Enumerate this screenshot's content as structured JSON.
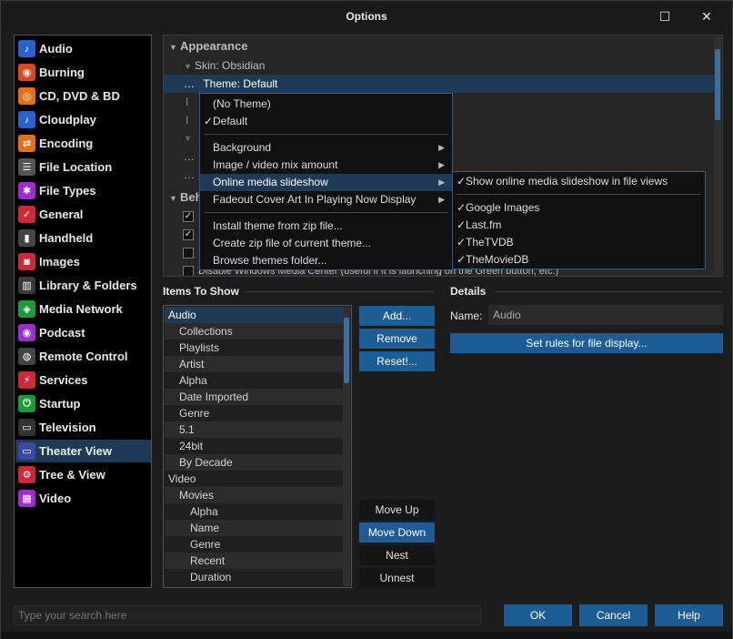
{
  "window": {
    "title": "Options",
    "maximize_glyph": "☐",
    "close_glyph": "✕"
  },
  "sidebar": {
    "items": [
      {
        "label": "Audio",
        "icon": "music-note-icon",
        "glyph": "♪",
        "color": "#2a62c9"
      },
      {
        "label": "Burning",
        "icon": "disc-burn-icon",
        "glyph": "◉",
        "color": "#d84a24"
      },
      {
        "label": "CD, DVD & BD",
        "icon": "cd-icon",
        "glyph": "◎",
        "color": "#e0701c"
      },
      {
        "label": "Cloudplay",
        "icon": "cloud-music-icon",
        "glyph": "♪",
        "color": "#2a62c9"
      },
      {
        "label": "Encoding",
        "icon": "convert-icon",
        "glyph": "⇄",
        "color": "#e0701c"
      },
      {
        "label": "File Location",
        "icon": "file-list-icon",
        "glyph": "☰",
        "color": "#555555"
      },
      {
        "label": "File Types",
        "icon": "puzzle-icon",
        "glyph": "✱",
        "color": "#9a2fc9"
      },
      {
        "label": "General",
        "icon": "checklist-icon",
        "glyph": "✓",
        "color": "#c92b3a"
      },
      {
        "label": "Handheld",
        "icon": "handheld-icon",
        "glyph": "▮",
        "color": "#444444"
      },
      {
        "label": "Images",
        "icon": "camera-icon",
        "glyph": "◙",
        "color": "#c92b3a"
      },
      {
        "label": "Library & Folders",
        "icon": "books-icon",
        "glyph": "▥",
        "color": "#3a3a3a"
      },
      {
        "label": "Media Network",
        "icon": "network-icon",
        "glyph": "◈",
        "color": "#1f9a3a"
      },
      {
        "label": "Podcast",
        "icon": "podcast-icon",
        "glyph": "◉",
        "color": "#9a2fc9"
      },
      {
        "label": "Remote Control",
        "icon": "remote-icon",
        "glyph": "◍",
        "color": "#444444"
      },
      {
        "label": "Services",
        "icon": "plug-icon",
        "glyph": "⚡",
        "color": "#c92b3a"
      },
      {
        "label": "Startup",
        "icon": "power-icon",
        "glyph": "⏻",
        "color": "#1f9a3a"
      },
      {
        "label": "Television",
        "icon": "tv-icon",
        "glyph": "▭",
        "color": "#333333"
      },
      {
        "label": "Theater View",
        "icon": "monitor-icon",
        "glyph": "▭",
        "color": "#3a4aa0"
      },
      {
        "label": "Tree & View",
        "icon": "gear-icon",
        "glyph": "⚙",
        "color": "#c92b3a"
      },
      {
        "label": "Video",
        "icon": "film-icon",
        "glyph": "▦",
        "color": "#9a2fc9"
      }
    ],
    "selected_index": 17
  },
  "settings": {
    "appearance_header": "Appearance",
    "skin_row": "Skin: Obsidian",
    "theme_row": "Theme: Default",
    "behavior_header_fragment": "Beh",
    "partial_row_text": "Disable Windows Media Center (useful if it is launching on the Green button, etc.)",
    "ellipsis": "…",
    "cursor_glyph": "I",
    "check_glyph": "✓",
    "checkboxes": [
      true,
      true,
      false,
      false
    ]
  },
  "theme_menu": {
    "items": [
      {
        "label": "(No Theme)",
        "checked": false,
        "submenu": false
      },
      {
        "label": "Default",
        "checked": true,
        "submenu": false
      },
      {
        "label": "Background",
        "checked": false,
        "submenu": true
      },
      {
        "label": "Image / video mix amount",
        "checked": false,
        "submenu": true
      },
      {
        "label": "Online media slideshow",
        "checked": false,
        "submenu": true
      },
      {
        "label": "Fadeout Cover Art In Playing Now Display",
        "checked": false,
        "submenu": true
      },
      {
        "label": "Install theme from zip file...",
        "checked": false,
        "submenu": false
      },
      {
        "label": "Create zip file of current theme...",
        "checked": false,
        "submenu": false
      },
      {
        "label": "Browse themes folder...",
        "checked": false,
        "submenu": false
      }
    ]
  },
  "slideshow_submenu": {
    "items": [
      {
        "label": "Show online media slideshow in file views",
        "checked": true
      },
      {
        "label": "Google Images",
        "checked": true
      },
      {
        "label": "Last.fm",
        "checked": true
      },
      {
        "label": "TheTVDB",
        "checked": true
      },
      {
        "label": "TheMovieDB",
        "checked": true
      }
    ]
  },
  "items_to_show": {
    "header": "Items To Show",
    "rows": [
      {
        "label": "Audio",
        "indent": 0
      },
      {
        "label": "Collections",
        "indent": 1
      },
      {
        "label": "Playlists",
        "indent": 1
      },
      {
        "label": "Artist",
        "indent": 1
      },
      {
        "label": "Alpha",
        "indent": 1
      },
      {
        "label": "Date Imported",
        "indent": 1
      },
      {
        "label": "Genre",
        "indent": 1
      },
      {
        "label": "5.1",
        "indent": 1
      },
      {
        "label": "24bit",
        "indent": 1
      },
      {
        "label": "By Decade",
        "indent": 1
      },
      {
        "label": "Video",
        "indent": 0
      },
      {
        "label": "Movies",
        "indent": 1
      },
      {
        "label": "Alpha",
        "indent": 2
      },
      {
        "label": "Name",
        "indent": 2
      },
      {
        "label": "Genre",
        "indent": 2
      },
      {
        "label": "Recent",
        "indent": 2
      },
      {
        "label": "Duration",
        "indent": 2
      }
    ],
    "selected_index": 0
  },
  "list_buttons": {
    "add": "Add...",
    "remove": "Remove",
    "reset": "Reset!..."
  },
  "move_buttons": {
    "move_up": "Move Up",
    "move_down": "Move Down",
    "nest": "Nest",
    "unnest": "Unnest"
  },
  "details": {
    "header": "Details",
    "name_label": "Name:",
    "name_value": "Audio",
    "rules_button": "Set rules for file display..."
  },
  "footer": {
    "search_placeholder": "Type your search here",
    "ok": "OK",
    "cancel": "Cancel",
    "help": "Help"
  },
  "colors": {
    "accent": "#1e5c95",
    "selection": "#1f3a57",
    "menu_border": "#2e5f8c"
  }
}
